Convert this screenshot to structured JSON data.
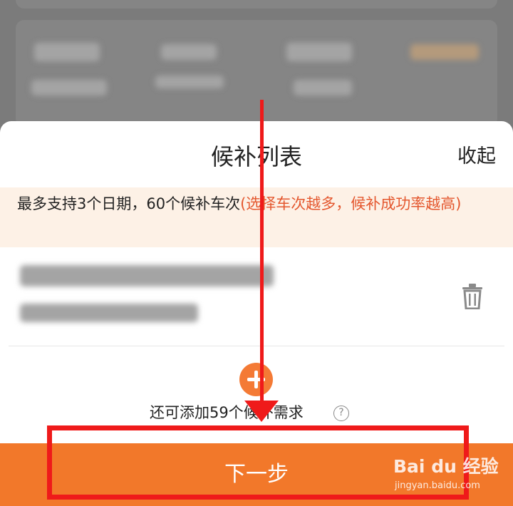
{
  "sheet": {
    "title": "候补列表",
    "collapse_label": "收起"
  },
  "notice": {
    "main": "最多支持3个日期，60个候补车次",
    "hint": "(选择车次越多，候补成功率越高)"
  },
  "add": {
    "remaining_text": "还可添加59个候补需求",
    "help_glyph": "?"
  },
  "footer": {
    "next_label": "下一步"
  },
  "icons": {
    "trash": "trash-icon",
    "add": "plus-circle-icon",
    "help": "question-circle-icon"
  },
  "colors": {
    "accent": "#f2782a",
    "hint": "#e4572e",
    "notice_bg": "#fdf1e6",
    "annotation": "#ef1a1a"
  },
  "watermark": {
    "logo": "Bai du 经验",
    "url": "jingyan.baidu.com"
  }
}
